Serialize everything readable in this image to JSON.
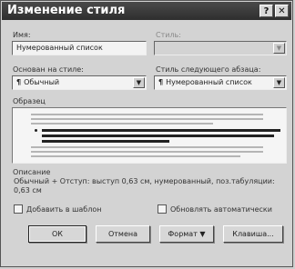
{
  "window": {
    "title": "Изменение стиля",
    "help_glyph": "?",
    "close_glyph": "✕"
  },
  "name": {
    "label": "Имя:",
    "value": "Нумерованный список"
  },
  "style_type": {
    "label": "Стиль:",
    "value": "",
    "disabled": true
  },
  "based_on": {
    "label": "Основан на стиле:",
    "value": "Обычный",
    "icon": "paragraph-icon"
  },
  "next_style": {
    "label": "Стиль следующего абзаца:",
    "value": "Нумерованный список",
    "icon": "paragraph-icon"
  },
  "preview": {
    "label": "Образец"
  },
  "description": {
    "label": "Описание",
    "text": "Обычный + Отступ: выступ 0,63 см, нумерованный, поз.табуляции: 0,63 см"
  },
  "options": {
    "add_to_template": "Добавить в шаблон",
    "auto_update": "Обновлять автоматически"
  },
  "buttons": {
    "ok": "ОК",
    "cancel": "Отмена",
    "format": "Формат",
    "shortcut": "Клавиша..."
  },
  "colors": {
    "titlebar": "#333333",
    "dialog_bg": "#d3d3d3"
  }
}
